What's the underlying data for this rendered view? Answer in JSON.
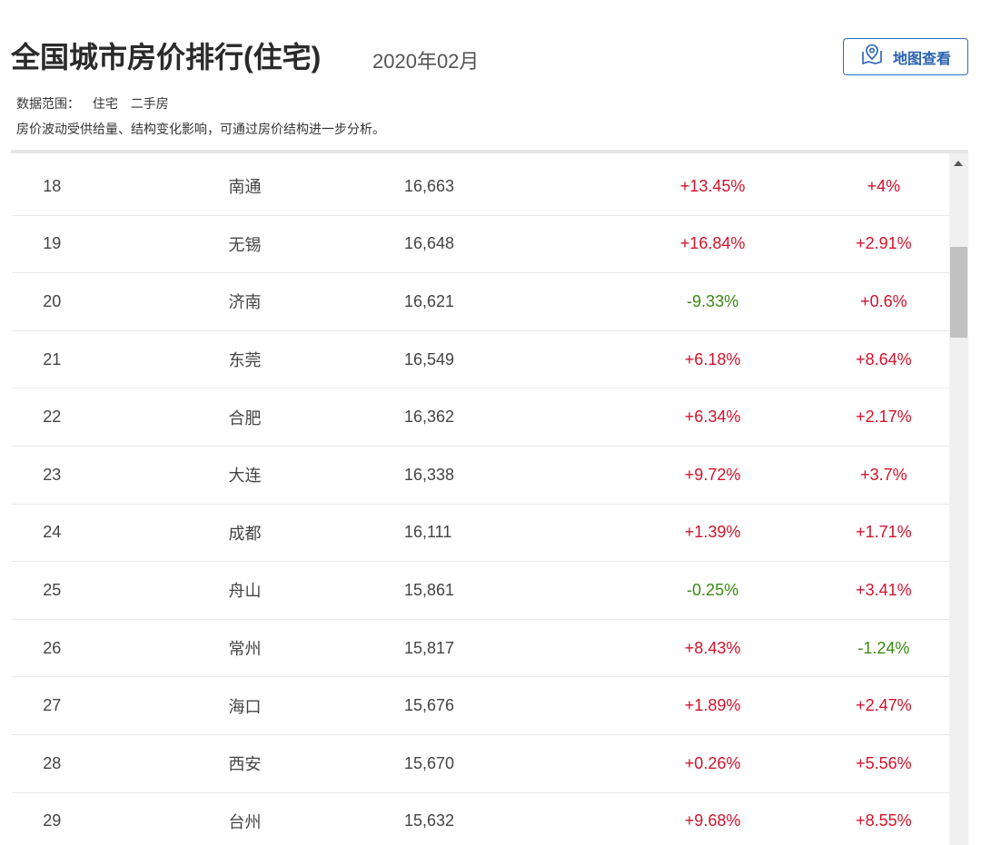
{
  "header": {
    "title": "全国城市房价排行(住宅)",
    "date": "2020年02月",
    "map_button": "地图查看"
  },
  "scope": {
    "label": "数据范围：",
    "type": "住宅",
    "market": "二手房"
  },
  "note": "房价波动受供给量、结构变化影响，可通过房价结构进一步分析。",
  "colors": {
    "up": "#d0132b",
    "down": "#3a8a12",
    "accent": "#2a6ebd"
  },
  "rows": [
    {
      "rank": "18",
      "city": "南通",
      "price": "16,663",
      "yoy": "+13.45%",
      "mom": "+4%"
    },
    {
      "rank": "19",
      "city": "无锡",
      "price": "16,648",
      "yoy": "+16.84%",
      "mom": "+2.91%"
    },
    {
      "rank": "20",
      "city": "济南",
      "price": "16,621",
      "yoy": "-9.33%",
      "mom": "+0.6%"
    },
    {
      "rank": "21",
      "city": "东莞",
      "price": "16,549",
      "yoy": "+6.18%",
      "mom": "+8.64%"
    },
    {
      "rank": "22",
      "city": "合肥",
      "price": "16,362",
      "yoy": "+6.34%",
      "mom": "+2.17%"
    },
    {
      "rank": "23",
      "city": "大连",
      "price": "16,338",
      "yoy": "+9.72%",
      "mom": "+3.7%"
    },
    {
      "rank": "24",
      "city": "成都",
      "price": "16,111",
      "yoy": "+1.39%",
      "mom": "+1.71%"
    },
    {
      "rank": "25",
      "city": "舟山",
      "price": "15,861",
      "yoy": "-0.25%",
      "mom": "+3.41%"
    },
    {
      "rank": "26",
      "city": "常州",
      "price": "15,817",
      "yoy": "+8.43%",
      "mom": "-1.24%"
    },
    {
      "rank": "27",
      "city": "海口",
      "price": "15,676",
      "yoy": "+1.89%",
      "mom": "+2.47%"
    },
    {
      "rank": "28",
      "city": "西安",
      "price": "15,670",
      "yoy": "+0.26%",
      "mom": "+5.56%"
    },
    {
      "rank": "29",
      "city": "台州",
      "price": "15,632",
      "yoy": "+9.68%",
      "mom": "+8.55%"
    }
  ]
}
